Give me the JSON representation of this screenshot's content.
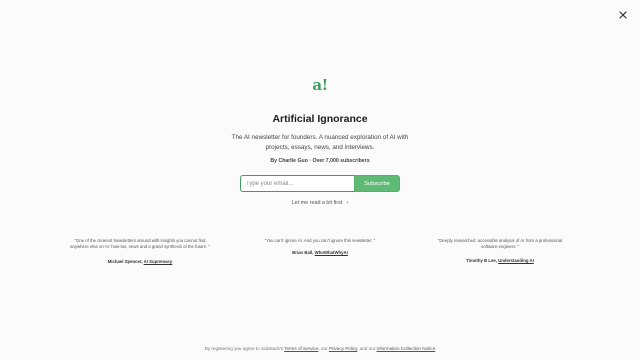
{
  "hero": {
    "logo_text": "a!",
    "title": "Artificial Ignorance",
    "description": "The AI newsletter for founders. A nuanced exploration of AI with projects, essays, news, and interviews.",
    "byline": "By Charlie Guo · Over 7,000 subscribers"
  },
  "form": {
    "email_placeholder": "Type your email...",
    "subscribe_label": "Subscribe"
  },
  "read_first_label": "Let me read a bit first",
  "testimonials": [
    {
      "quote": "“One of the clearest Newsletters around with insights you cannot find anywhere else on AI: how-tos, news and a grand synthesis of the future. ”",
      "name": "Michael Spencer,",
      "org": "AI Supremacy"
    },
    {
      "quote": "“You can't ignore AI. And you can't ignore this newsletter. ”",
      "name": "Brian Ball,",
      "org": "WhoWhatWhyAI"
    },
    {
      "quote": "“Deeply researched, accessible analysis of AI from a professional software engineer. ”",
      "name": "Timothy B Lee,",
      "org": "Understanding AI"
    }
  ],
  "footer": {
    "prefix": "By registering you agree to Substack's",
    "terms": "Terms of Service",
    "mid1": ", our",
    "privacy": "Privacy Policy",
    "mid2": ", and our",
    "notice": "Information Collection Notice"
  },
  "colors": {
    "accent": "#5fba76",
    "logo": "#3f9e5e",
    "background": "#fbfbfb"
  },
  "icons": {
    "close": "close-icon",
    "chevron": "chevron-right-icon"
  }
}
